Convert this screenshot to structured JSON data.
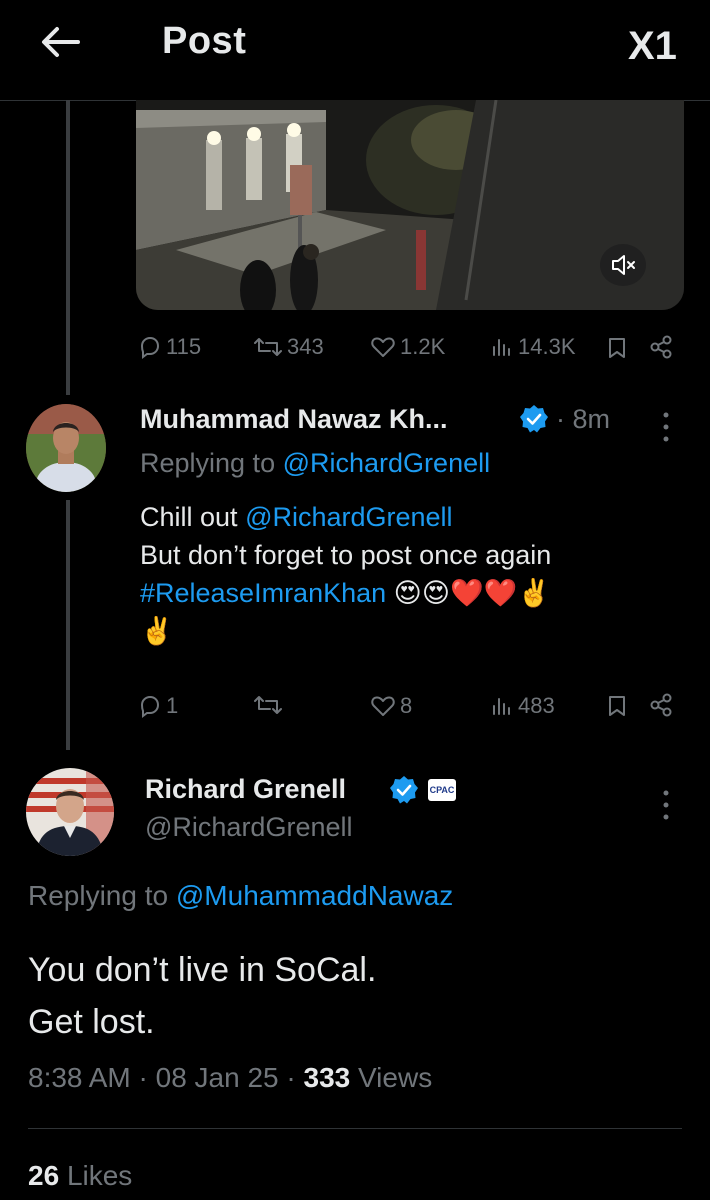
{
  "header": {
    "title": "Post",
    "logo_text": "X1"
  },
  "media_tweet": {
    "stats": {
      "replies": "115",
      "reposts": "343",
      "likes": "1.2K",
      "views": "14.3K"
    }
  },
  "reply_tweet": {
    "author_name": "Muhammad Nawaz Kh...",
    "time": "· 8m",
    "replying_prefix": "Replying to",
    "replying_handle": "@RichardGrenell",
    "text_line1_prefix": "Chill out",
    "text_line1_mention": "@RichardGrenell",
    "text_line2": "But don’t forget to post once again",
    "text_line3_hashtag": "#ReleaseImranKhan",
    "emoji_line3": "😍😍❤️❤️✌️",
    "emoji_line4": "✌️",
    "stats": {
      "replies": "1",
      "reposts": "",
      "likes": "8",
      "views": "483"
    }
  },
  "main_tweet": {
    "author_name": "Richard Grenell",
    "badge_text": "CPAC",
    "handle": "@RichardGrenell",
    "replying_prefix": "Replying to",
    "replying_handle": "@MuhammaddNawaz",
    "text_line1": "You don’t live in SoCal.",
    "text_line2": "Get lost.",
    "time": "8:38 AM",
    "date": "08 Jan 25",
    "views_count": "333",
    "views_label": "Views",
    "likes_count": "26",
    "likes_label": "Likes"
  },
  "colors": {
    "accent": "#1d9bf0",
    "muted": "#71767b",
    "text": "#e7e9ea",
    "background": "#000000",
    "heart": "#e0245e"
  }
}
